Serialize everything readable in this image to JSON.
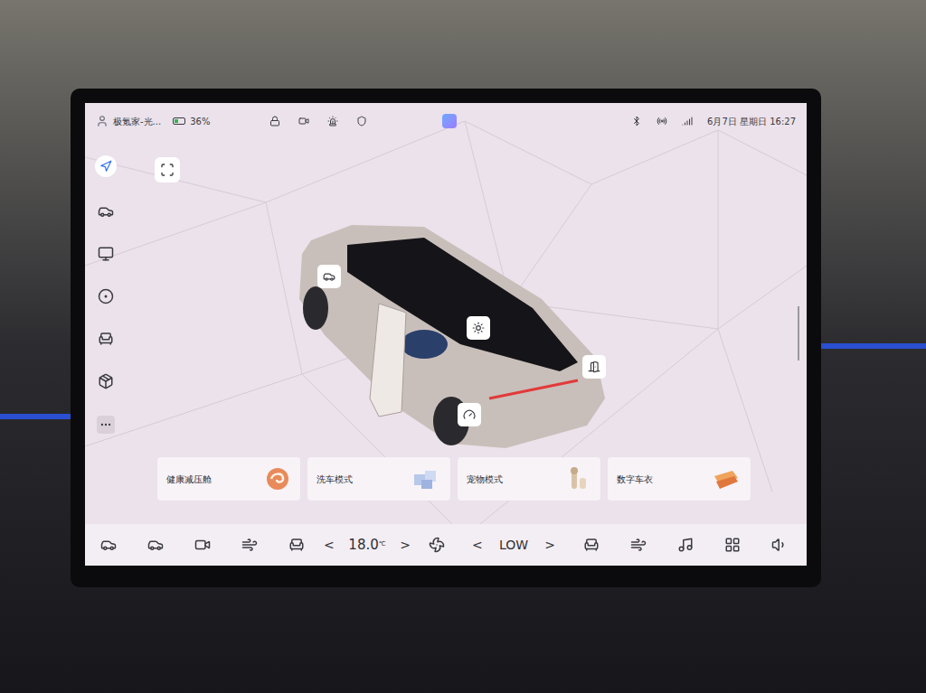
{
  "status_bar": {
    "account": "极氪家-光...",
    "battery": {
      "text": "36%",
      "level": 0.36
    },
    "datetime": "6月7日 星期日 16:27"
  },
  "cards": [
    {
      "label": "健康减压舱"
    },
    {
      "label": "洗车模式"
    },
    {
      "label": "宠物模式"
    },
    {
      "label": "数字车衣"
    }
  ],
  "climate": {
    "temperature": {
      "value": "18.0",
      "unit": "℃",
      "down": "<",
      "up": ">"
    },
    "fan_level": {
      "value": "LOW",
      "down": "<",
      "up": ">"
    }
  }
}
